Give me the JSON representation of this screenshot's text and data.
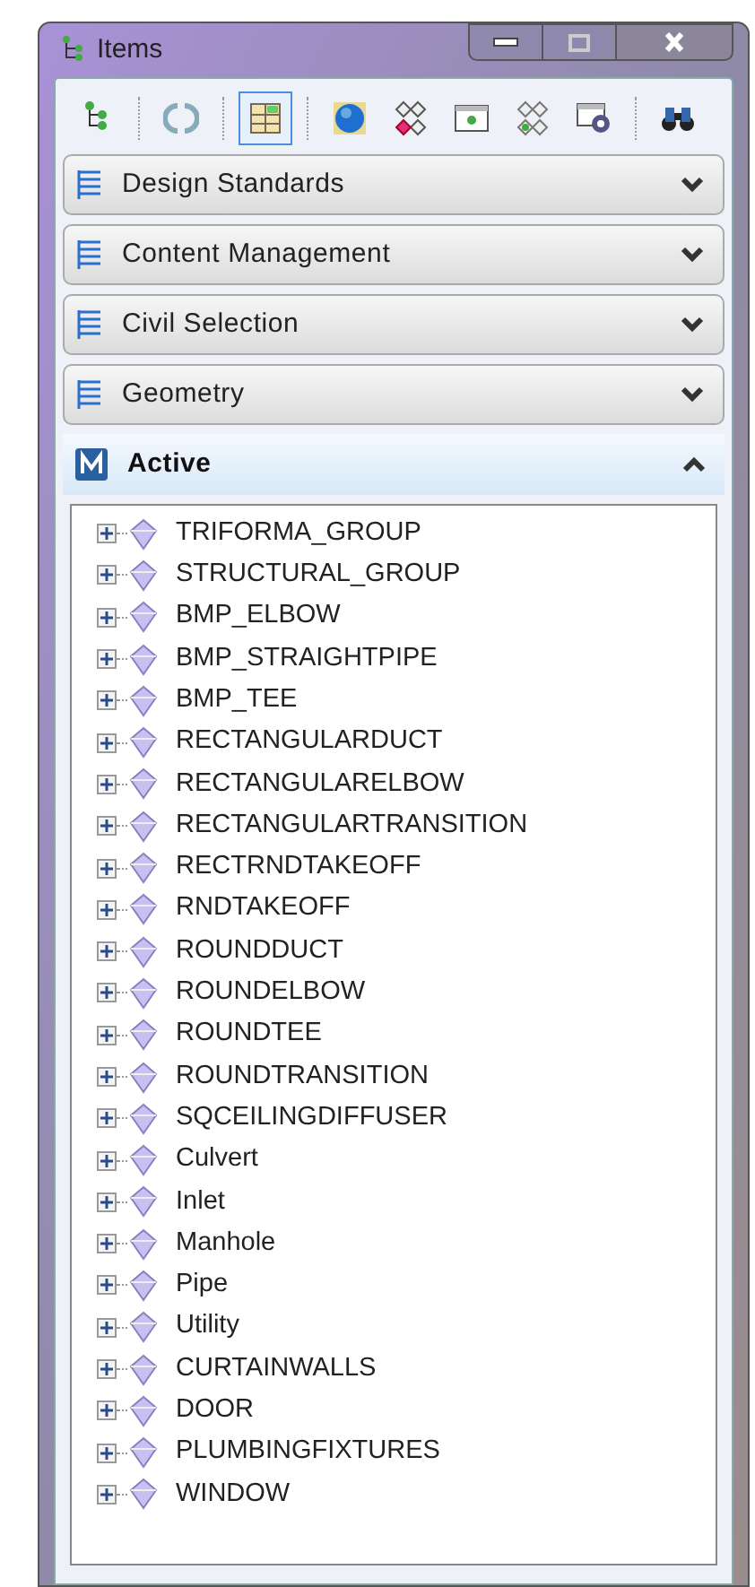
{
  "window": {
    "title": "Items"
  },
  "toolbar": [
    {
      "kind": "tree",
      "selected": false
    },
    {
      "kind": "sep"
    },
    {
      "kind": "refresh",
      "selected": false
    },
    {
      "kind": "sep"
    },
    {
      "kind": "grid",
      "selected": true
    },
    {
      "kind": "sep"
    },
    {
      "kind": "globe",
      "selected": false
    },
    {
      "kind": "cluster-red",
      "selected": false
    },
    {
      "kind": "window",
      "selected": false
    },
    {
      "kind": "cluster",
      "selected": false
    },
    {
      "kind": "window-gear",
      "selected": false
    },
    {
      "kind": "sep"
    },
    {
      "kind": "binoculars",
      "selected": false
    }
  ],
  "panels": [
    {
      "title": "Design Standards",
      "expanded": false
    },
    {
      "title": "Content Management",
      "expanded": false
    },
    {
      "title": "Civil Selection",
      "expanded": false
    },
    {
      "title": "Geometry",
      "expanded": false
    },
    {
      "title": "Active",
      "expanded": true
    }
  ],
  "tree": [
    {
      "label": "TRIFORMA_GROUP",
      "expanded": false
    },
    {
      "label": "STRUCTURAL_GROUP",
      "expanded": false
    },
    {
      "label": "BMP_ELBOW",
      "expanded": false
    },
    {
      "label": "BMP_STRAIGHTPIPE",
      "expanded": false
    },
    {
      "label": "BMP_TEE",
      "expanded": false
    },
    {
      "label": "RECTANGULARDUCT",
      "expanded": false
    },
    {
      "label": "RECTANGULARELBOW",
      "expanded": false
    },
    {
      "label": "RECTANGULARTRANSITION",
      "expanded": false
    },
    {
      "label": "RECTRNDTAKEOFF",
      "expanded": false
    },
    {
      "label": "RNDTAKEOFF",
      "expanded": false
    },
    {
      "label": "ROUNDDUCT",
      "expanded": false
    },
    {
      "label": "ROUNDELBOW",
      "expanded": false
    },
    {
      "label": "ROUNDTEE",
      "expanded": false
    },
    {
      "label": "ROUNDTRANSITION",
      "expanded": false
    },
    {
      "label": "SQCEILINGDIFFUSER",
      "expanded": false
    },
    {
      "label": "Culvert",
      "expanded": false
    },
    {
      "label": "Inlet",
      "expanded": false
    },
    {
      "label": "Manhole",
      "expanded": false
    },
    {
      "label": "Pipe",
      "expanded": false
    },
    {
      "label": "Utility",
      "expanded": false
    },
    {
      "label": "CURTAINWALLS",
      "expanded": false
    },
    {
      "label": "DOOR",
      "expanded": false
    },
    {
      "label": "PLUMBINGFIXTURES",
      "expanded": false
    },
    {
      "label": "WINDOW",
      "expanded": false
    }
  ]
}
